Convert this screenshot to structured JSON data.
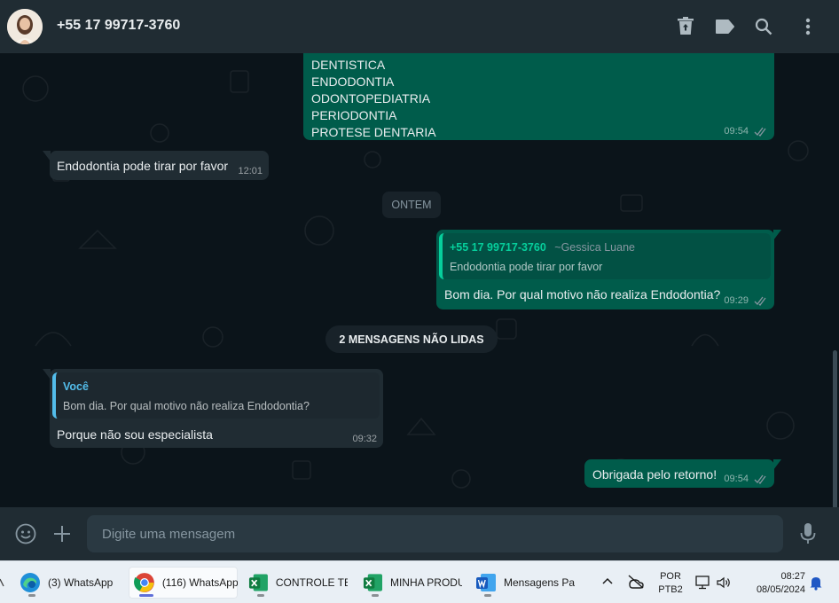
{
  "header": {
    "contact_name": "+55 17 99717-3760"
  },
  "chat": {
    "list_message": {
      "lines": [
        "DENTISTICA",
        "ENDODONTIA",
        "ODONTOPEDIATRIA",
        "PERIODONTIA",
        "PROTESE DENTARIA"
      ],
      "time": "09:54"
    },
    "incoming_1": {
      "text": "Endodontia pode tirar por favor",
      "time": "12:01"
    },
    "date_divider": "ONTEM",
    "reply_out": {
      "quote_author": "+55 17 99717-3760",
      "quote_author_alias": "~Gessica Luane",
      "quote_text": "Endodontia pode tirar por favor",
      "text": "Bom dia. Por qual motivo não realiza Endodontia?",
      "time": "09:29"
    },
    "unread_divider": "2 MENSAGENS NÃO LIDAS",
    "reply_in": {
      "quote_author": "Você",
      "quote_text": "Bom dia. Por qual motivo não realiza Endodontia?",
      "text": "Porque não sou especialista",
      "time": "09:32"
    },
    "outgoing_last": {
      "text": "Obrigada pelo retorno!",
      "time": "09:54"
    }
  },
  "composer": {
    "placeholder": "Digite uma mensagem"
  },
  "taskbar": {
    "items": [
      {
        "label": "(3) WhatsApp",
        "icon": "edge-icon"
      },
      {
        "label": "(116) WhatsApp",
        "icon": "chrome-icon"
      },
      {
        "label": "CONTROLE TE",
        "icon": "excel-icon"
      },
      {
        "label": "MINHA PRODU",
        "icon": "excel-icon"
      },
      {
        "label": "Mensagens Pa",
        "icon": "word-icon"
      }
    ],
    "lang_top": "POR",
    "lang_bottom": "PTB2",
    "clock_time": "08:27",
    "clock_date": "08/05/2024"
  },
  "colors": {
    "header_bg": "#202c33",
    "chat_bg": "#0b141a",
    "outgoing_bubble": "#005c4b",
    "incoming_bubble": "#202c33",
    "accent_green": "#06cf9c",
    "accent_blue": "#53bdeb"
  }
}
